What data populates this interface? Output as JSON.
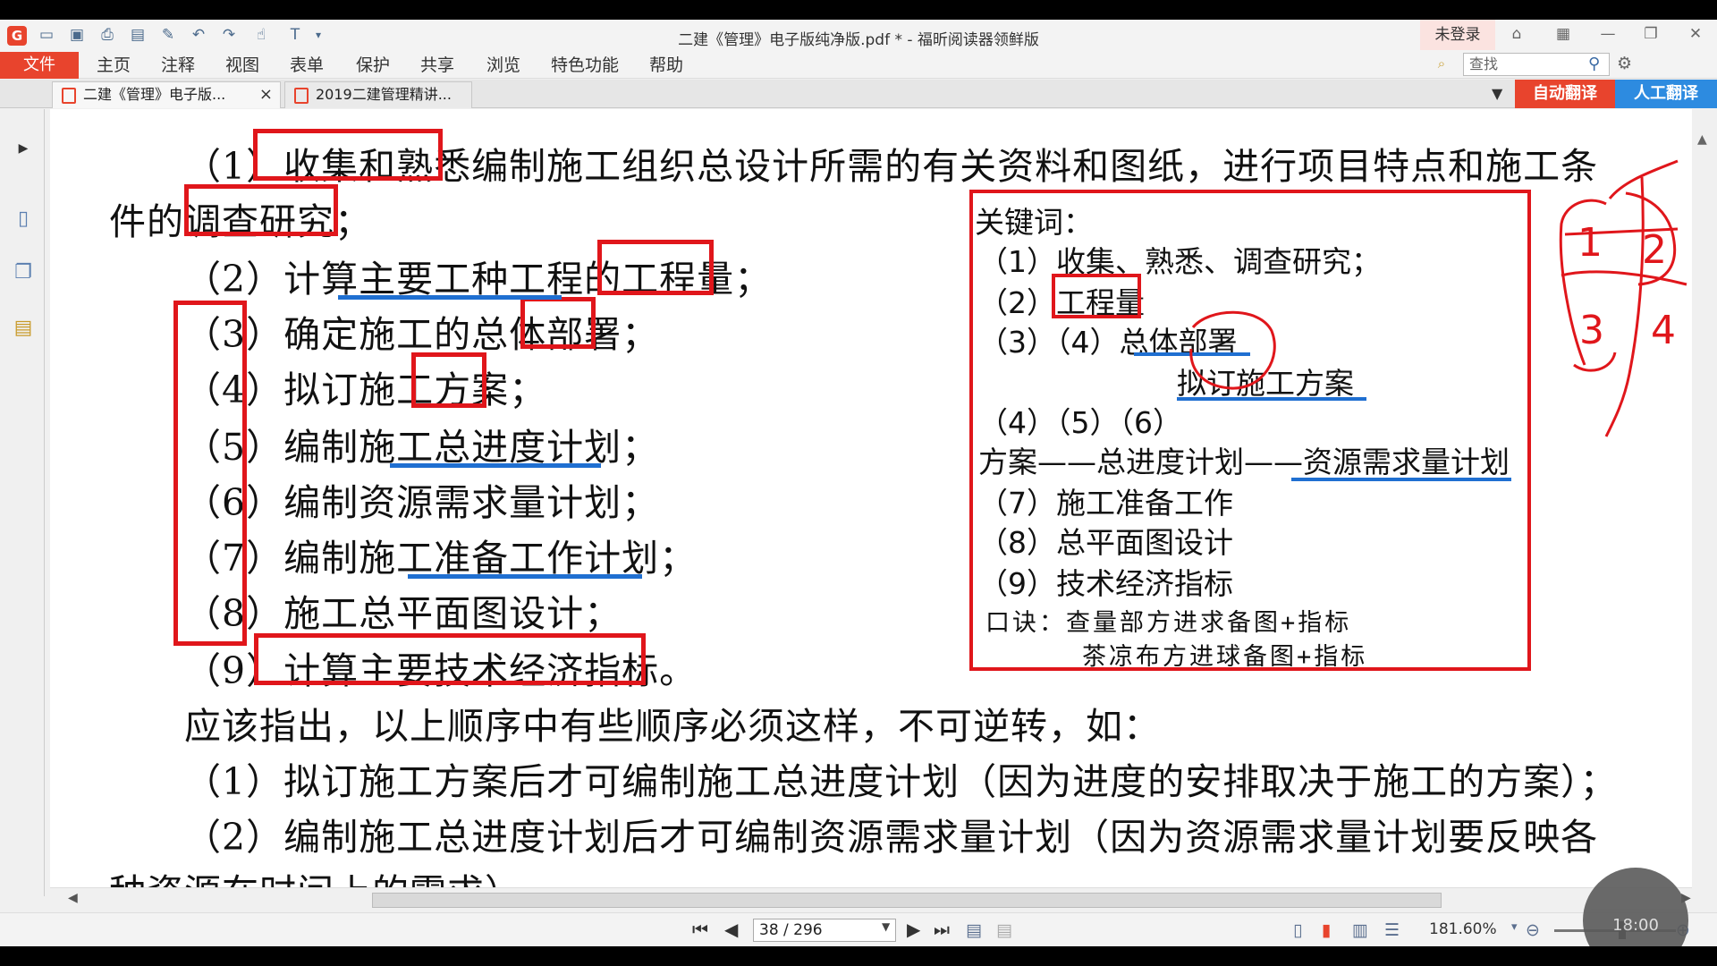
{
  "window": {
    "title": "二建《管理》电子版纯净版.pdf * - 福昕阅读器领鲜版",
    "login": "未登录"
  },
  "menu": {
    "file": "文件",
    "items": [
      "主页",
      "注释",
      "视图",
      "表单",
      "保护",
      "共享",
      "浏览",
      "特色功能",
      "帮助"
    ],
    "search_placeholder": "查找"
  },
  "tabs": [
    {
      "label": "二建《管理》电子版...",
      "close": "×"
    },
    {
      "label": "2019二建管理精讲..."
    }
  ],
  "translate": {
    "auto": "自动翻译",
    "human": "人工翻译"
  },
  "doc": {
    "lines": [
      "（1）收集和熟悉编制施工组织总设计所需的有关资料和图纸，进行项目特点和施工条",
      "件的调查研究；",
      "（2）计算主要工种工程的工程量；",
      "（3）确定施工的总体部署；",
      "（4）拟订施工方案；",
      "（5）编制施工总进度计划；",
      "（6）编制资源需求量计划；",
      "（7）编制施工准备工作计划；",
      "（8）施工总平面图设计；",
      "（9）计算主要技术经济指标。",
      "应该指出，以上顺序中有些顺序必须这样，不可逆转，如：",
      "（1）拟订施工方案后才可编制施工总进度计划（因为进度的安排取决于施工的方案）；",
      "（2）编制施工总进度计划后才可编制资源需求量计划（因为资源需求量计划要反映各",
      "种资源在时间上的需求）。"
    ],
    "keywords": {
      "title": "关键词：",
      "items": [
        "（1）收集、熟悉、调查研究；",
        "（2）工程量",
        "（3）（4）总体部署",
        "拟订施工方案",
        "（4）（5）（6）",
        "方案——总进度计划——资源需求量计划",
        "（7）施工准备工作",
        "（8）总平面图设计",
        "（9）技术经济指标"
      ],
      "mnemonic_1": "口诀：查量部方进求备图+指标",
      "mnemonic_2": "茶凉布方进球备图+指标"
    },
    "handwriting_digits": [
      "1",
      "2",
      "3",
      "4"
    ]
  },
  "status": {
    "page": "38 / 296",
    "zoom": "181.60%",
    "timer": "18:00"
  }
}
